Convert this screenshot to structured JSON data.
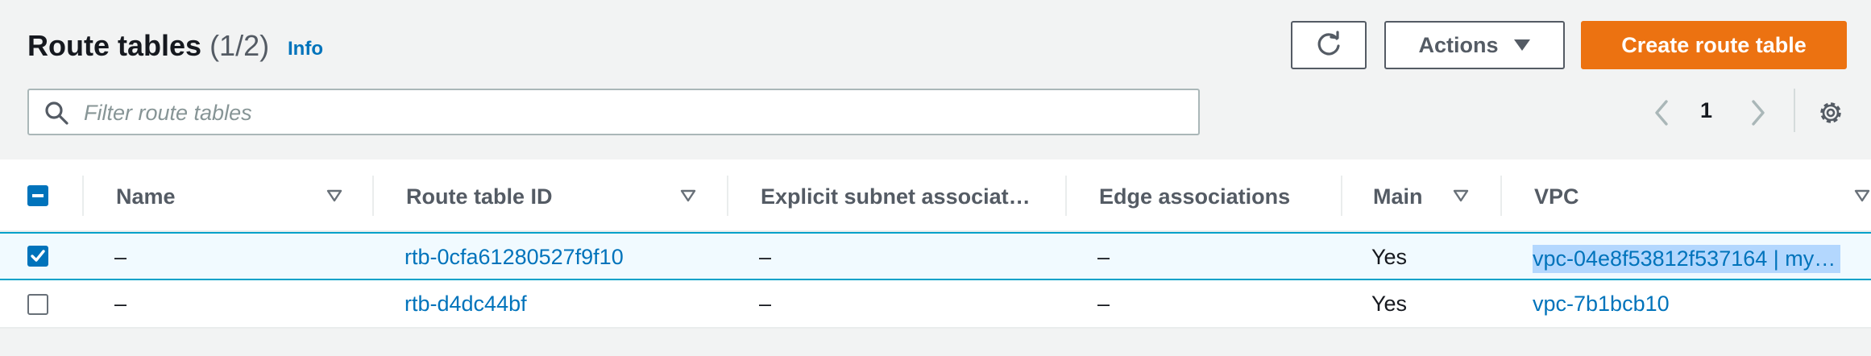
{
  "header": {
    "title": "Route tables",
    "count": "(1/2)",
    "info_link": "Info",
    "actions_label": "Actions",
    "create_label": "Create route table"
  },
  "search": {
    "placeholder": "Filter route tables",
    "value": ""
  },
  "pagination": {
    "current_page": "1"
  },
  "table": {
    "columns": [
      "Name",
      "Route table ID",
      "Explicit subnet associat…",
      "Edge associations",
      "Main",
      "VPC"
    ],
    "rows": [
      {
        "selected": true,
        "name": "–",
        "route_table_id": "rtb-0cfa61280527f9f10",
        "explicit_subnet": "–",
        "edge": "–",
        "main": "Yes",
        "vpc": "vpc-04e8f53812f537164 | my…"
      },
      {
        "selected": false,
        "name": "–",
        "route_table_id": "rtb-d4dc44bf",
        "explicit_subnet": "–",
        "edge": "–",
        "main": "Yes",
        "vpc": "vpc-7b1bcb10"
      }
    ]
  },
  "colors": {
    "primary": "#ec7211",
    "link": "#0073bb",
    "selected_row_border": "#00a1c9",
    "selected_row_bg": "#f1faff"
  },
  "icons": {
    "refresh": "refresh-icon",
    "caret": "caret-down-icon",
    "search": "search-icon",
    "prev": "chevron-left-icon",
    "next": "chevron-right-icon",
    "settings": "gear-icon",
    "sort": "sort-down-icon"
  }
}
